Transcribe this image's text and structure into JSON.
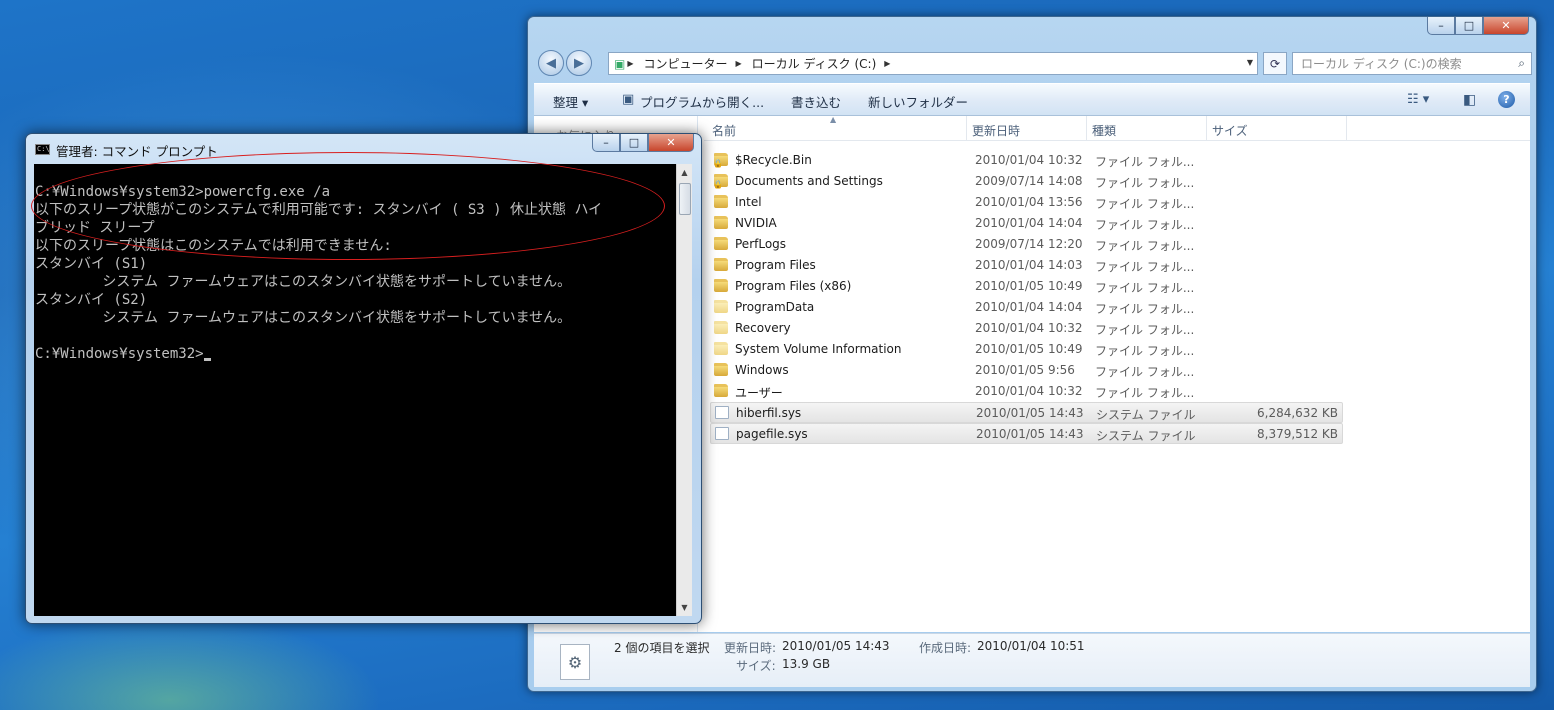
{
  "explorer": {
    "caption_buttons": {
      "minimize": "–",
      "maximize": "□",
      "close": "✕"
    },
    "address": {
      "crumbs": [
        "コンピューター",
        "ローカル ディスク (C:)"
      ]
    },
    "search_placeholder": "ローカル ディスク (C:)の検索",
    "toolbar": {
      "organize": "整理 ▾",
      "open_with": "プログラムから開く...",
      "burn": "書き込む",
      "new_folder": "新しいフォルダー",
      "help": "?"
    },
    "navpane": {
      "favorites": "お気に入り"
    },
    "columns": {
      "name": "名前",
      "modified": "更新日時",
      "type": "種類",
      "size": "サイズ"
    },
    "files": [
      {
        "name": "$Recycle.Bin",
        "modified": "2010/01/04 10:32",
        "type": "ファイル フォル...",
        "size": "",
        "kind": "folder-lock"
      },
      {
        "name": "Documents and Settings",
        "modified": "2009/07/14 14:08",
        "type": "ファイル フォル...",
        "size": "",
        "kind": "folder-lock"
      },
      {
        "name": "Intel",
        "modified": "2010/01/04 13:56",
        "type": "ファイル フォル...",
        "size": "",
        "kind": "folder"
      },
      {
        "name": "NVIDIA",
        "modified": "2010/01/04 14:04",
        "type": "ファイル フォル...",
        "size": "",
        "kind": "folder"
      },
      {
        "name": "PerfLogs",
        "modified": "2009/07/14 12:20",
        "type": "ファイル フォル...",
        "size": "",
        "kind": "folder"
      },
      {
        "name": "Program Files",
        "modified": "2010/01/04 14:03",
        "type": "ファイル フォル...",
        "size": "",
        "kind": "folder"
      },
      {
        "name": "Program Files (x86)",
        "modified": "2010/01/05 10:49",
        "type": "ファイル フォル...",
        "size": "",
        "kind": "folder"
      },
      {
        "name": "ProgramData",
        "modified": "2010/01/04 14:04",
        "type": "ファイル フォル...",
        "size": "",
        "kind": "folder-pale"
      },
      {
        "name": "Recovery",
        "modified": "2010/01/04 10:32",
        "type": "ファイル フォル...",
        "size": "",
        "kind": "folder-pale"
      },
      {
        "name": "System Volume Information",
        "modified": "2010/01/05 10:49",
        "type": "ファイル フォル...",
        "size": "",
        "kind": "folder-pale"
      },
      {
        "name": "Windows",
        "modified": "2010/01/05 9:56",
        "type": "ファイル フォル...",
        "size": "",
        "kind": "folder"
      },
      {
        "name": "ユーザー",
        "modified": "2010/01/04 10:32",
        "type": "ファイル フォル...",
        "size": "",
        "kind": "folder"
      },
      {
        "name": "hiberfil.sys",
        "modified": "2010/01/05 14:43",
        "type": "システム ファイル",
        "size": "6,284,632 KB",
        "kind": "sysfile",
        "selected": true
      },
      {
        "name": "pagefile.sys",
        "modified": "2010/01/05 14:43",
        "type": "システム ファイル",
        "size": "8,379,512 KB",
        "kind": "sysfile",
        "selected": true
      }
    ],
    "details": {
      "selection": "2 個の項目を選択",
      "modified_label": "更新日時:",
      "modified_value": "2010/01/05 14:43",
      "created_label": "作成日時:",
      "created_value": "2010/01/04 10:51",
      "size_label": "サイズ:",
      "size_value": "13.9 GB"
    }
  },
  "cmd": {
    "title": "管理者: コマンド プロンプト",
    "icon_text": "C:\\",
    "caption_buttons": {
      "minimize": "–",
      "maximize": "□",
      "close": "✕"
    },
    "lines": [
      "C:¥Windows¥system32>powercfg.exe /a",
      "以下のスリープ状態がこのシステムで利用可能です: スタンバイ ( S3 ) 休止状態 ハイ",
      "ブリッド スリープ",
      "以下のスリープ状態はこのシステムでは利用できません:",
      "スタンバイ (S1)",
      "        システム ファームウェアはこのスタンバイ状態をサポートしていません。",
      "スタンバイ (S2)",
      "        システム ファームウェアはこのスタンバイ状態をサポートしていません。",
      "",
      "C:¥Windows¥system32>"
    ]
  },
  "colors": {
    "console_bg": "#000000",
    "console_text": "#c0c0c0",
    "annotation": "#d81f1f",
    "desktop": "#1e74c8"
  }
}
